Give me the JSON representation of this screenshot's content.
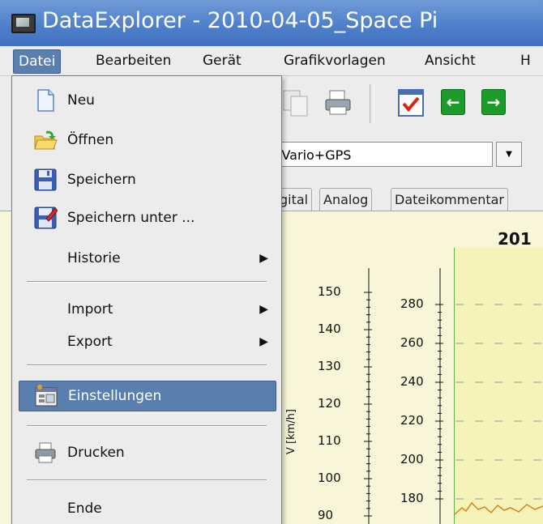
{
  "window": {
    "title": "DataExplorer - 2010-04-05_Space Pi"
  },
  "menubar": {
    "items": [
      {
        "label": "Datei"
      },
      {
        "label": "Bearbeiten"
      },
      {
        "label": "Gerät"
      },
      {
        "label": "Grafikvorlagen"
      },
      {
        "label": "Ansicht"
      },
      {
        "label": "H"
      }
    ]
  },
  "device": {
    "selected": ": Vario+GPS"
  },
  "tabs": [
    {
      "label": "gital"
    },
    {
      "label": "Analog"
    },
    {
      "label": "Dateikommentar"
    }
  ],
  "graph": {
    "title": "201",
    "axis1": {
      "ticks": [
        "150",
        "140",
        "130",
        "120",
        "110",
        "100",
        "90"
      ],
      "label": "V  [km/h]"
    },
    "axis2": {
      "ticks": [
        "280",
        "260",
        "240",
        "220",
        "200",
        "180"
      ]
    }
  },
  "file_menu": {
    "items": [
      {
        "label": "Neu",
        "icon": "new-file-icon"
      },
      {
        "label": "Öffnen",
        "icon": "folder-open-icon"
      },
      {
        "label": "Speichern",
        "icon": "save-icon"
      },
      {
        "label": "Speichern unter ...",
        "icon": "save-as-icon"
      },
      {
        "label": "Historie",
        "submenu": true
      },
      {
        "label": "Import",
        "submenu": true
      },
      {
        "label": "Export",
        "submenu": true
      },
      {
        "label": "Einstellungen",
        "icon": "settings-icon",
        "highlighted": true
      },
      {
        "label": "Drucken",
        "icon": "printer-icon"
      },
      {
        "label": "Ende"
      }
    ]
  },
  "colors": {
    "accent": "#5a7fae",
    "titlebar": "#4d7ec9",
    "plot_bg": "#f6f3b9"
  }
}
